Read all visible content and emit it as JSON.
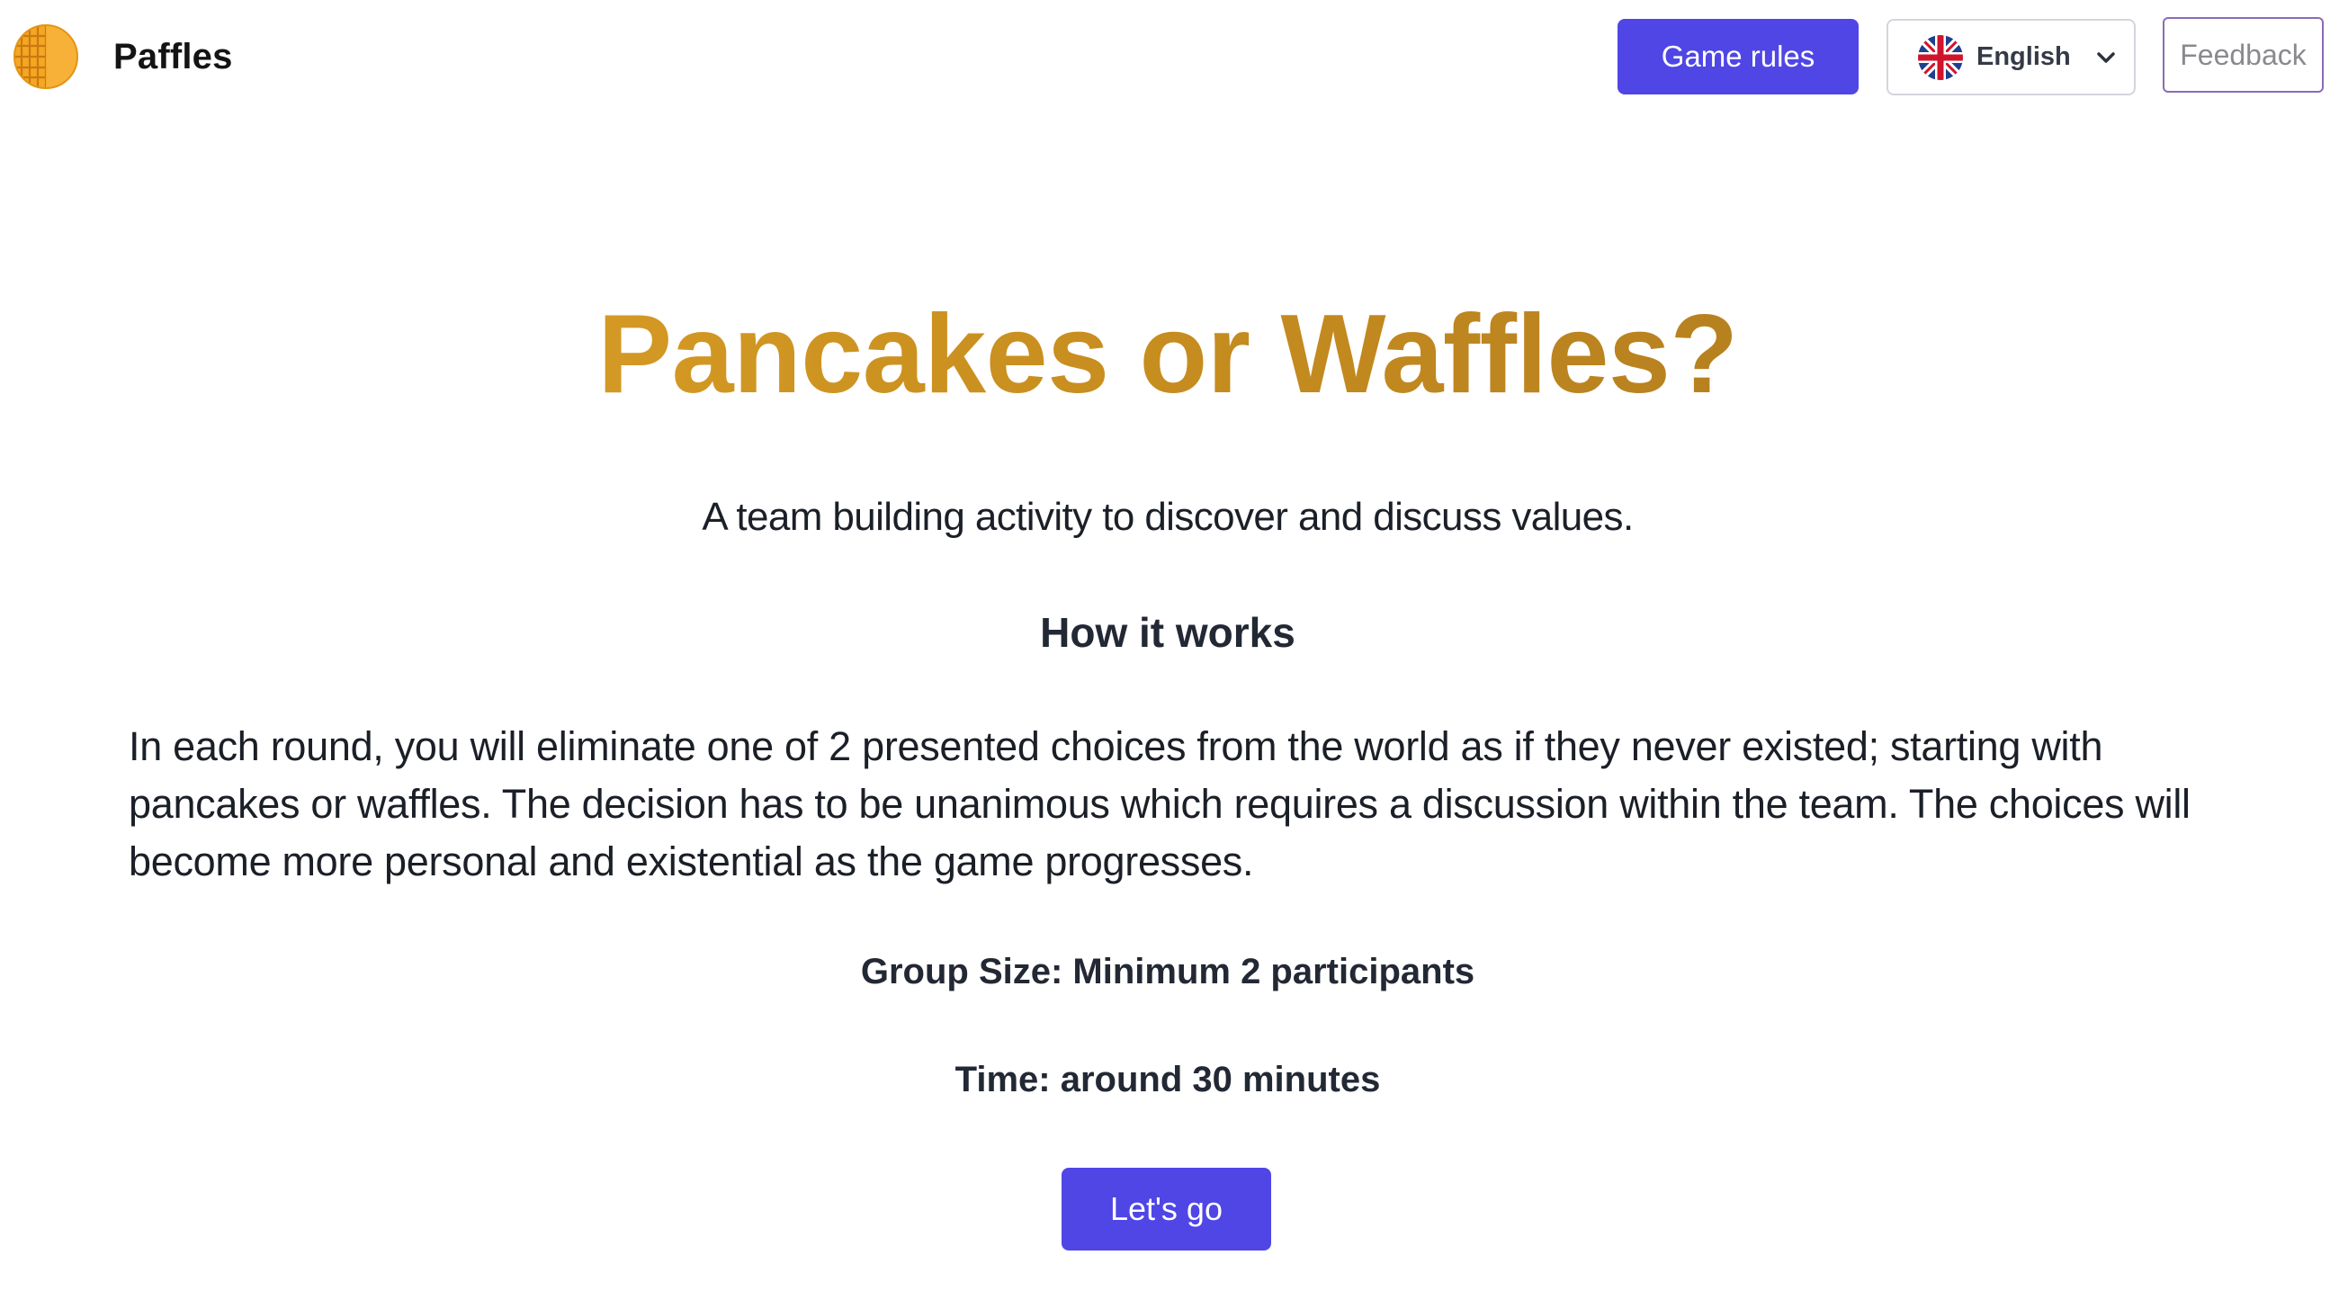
{
  "header": {
    "brand_name": "Paffles",
    "game_rules_label": "Game rules",
    "language": {
      "selected": "English",
      "flag_icon": "uk-flag-icon"
    },
    "feedback_label": "Feedback"
  },
  "main": {
    "title": "Pancakes or Waffles?",
    "tagline": "A team building activity to discover and discuss values.",
    "how_it_works_heading": "How it works",
    "description": "In each round, you will eliminate one of 2 presented choices from the world as if they never existed; starting with pancakes or waffles. The decision has to be unanimous which requires a discussion within the team. The choices will become more personal and existential as the game progresses.",
    "group_size": "Group Size: Minimum 2 participants",
    "time": "Time: around 30 minutes",
    "cta_label": "Let's go"
  },
  "colors": {
    "primary": "#4f46e5",
    "title_gradient_start": "#e2a72a",
    "title_gradient_end": "#a87420",
    "feedback_border": "#8b6bb8",
    "logo_orange": "#f5a623"
  }
}
